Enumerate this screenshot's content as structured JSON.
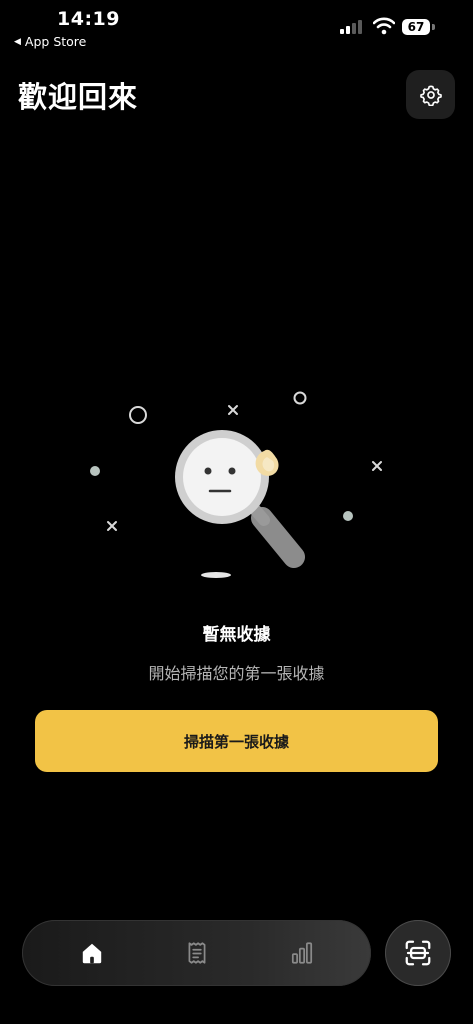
{
  "status_bar": {
    "time": "14:19",
    "back_label": "App Store",
    "battery": "67"
  },
  "header": {
    "title": "歡迎回來",
    "settings_icon": "gear-icon"
  },
  "empty_state": {
    "title": "暫無收據",
    "subtitle": "開始掃描您的第一張收據",
    "illustration_icon": "magnifier-sad-face-icon"
  },
  "cta": {
    "label": "掃描第一張收據"
  },
  "tab_bar": {
    "tabs": [
      {
        "icon": "home-icon",
        "active": true
      },
      {
        "icon": "receipt-icon",
        "active": false
      },
      {
        "icon": "bar-chart-icon",
        "active": false
      }
    ],
    "scan_icon": "scan-icon"
  },
  "colors": {
    "background": "#000000",
    "accent": "#f2c346",
    "tabbar": "#1a1a1a"
  }
}
